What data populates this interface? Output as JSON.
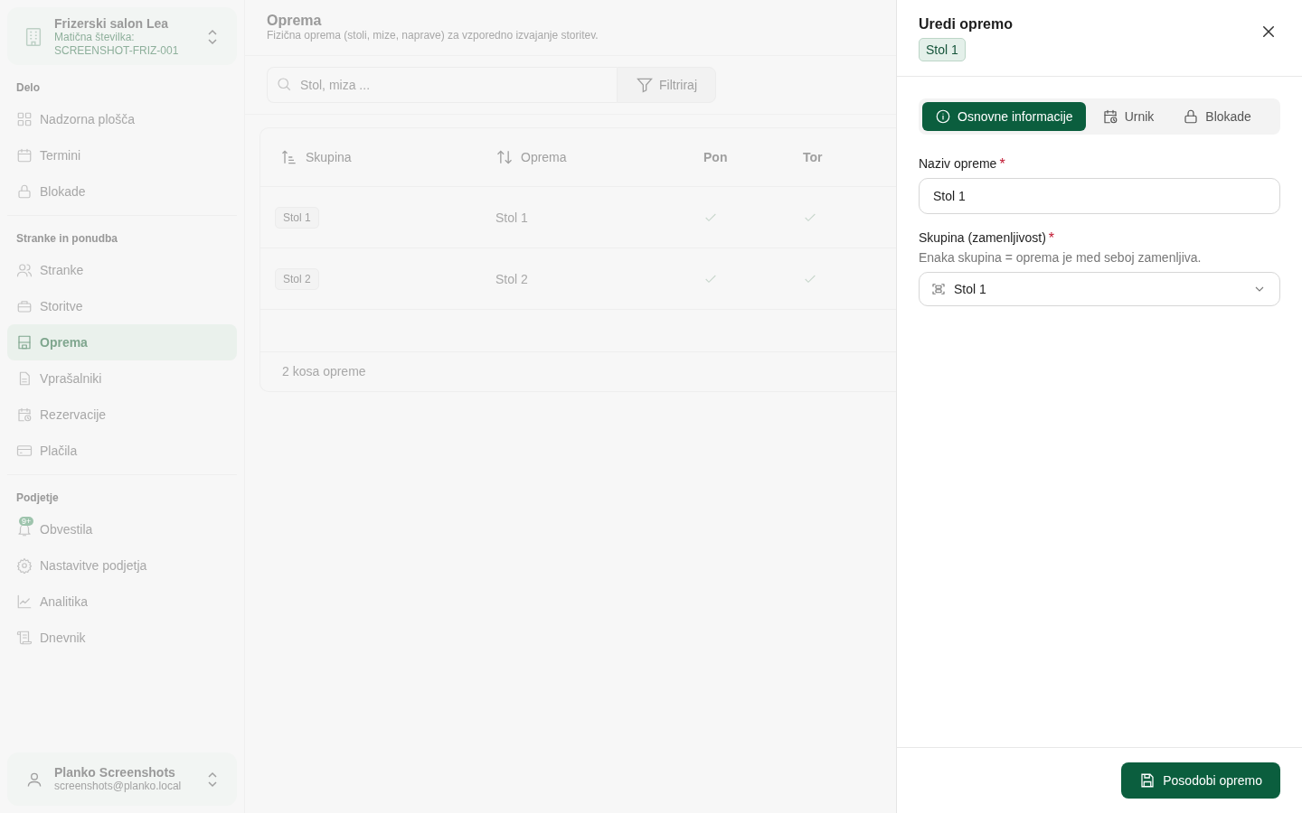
{
  "sidebar": {
    "org": {
      "name": "Frizerski salon Lea",
      "id_label": "Matična številka:",
      "id_value": "SCREENSHOT-FRIZ-001"
    },
    "sections": [
      {
        "title": "Delo",
        "items": [
          {
            "label": "Nadzorna plošča",
            "kind": "dashboard",
            "selected": false
          },
          {
            "label": "Termini",
            "kind": "calendar",
            "selected": false
          },
          {
            "label": "Blokade",
            "kind": "lock",
            "selected": false
          }
        ]
      },
      {
        "title": "Stranke in ponudba",
        "items": [
          {
            "label": "Stranke",
            "kind": "users",
            "selected": false
          },
          {
            "label": "Storitve",
            "kind": "briefcase",
            "selected": false
          },
          {
            "label": "Oprema",
            "kind": "equipment",
            "selected": true
          },
          {
            "label": "Vprašalniki",
            "kind": "document",
            "selected": false
          },
          {
            "label": "Rezervacije",
            "kind": "calendarclock",
            "selected": false
          },
          {
            "label": "Plačila",
            "kind": "card",
            "selected": false
          }
        ]
      },
      {
        "title": "Podjetje",
        "items": [
          {
            "label": "Obvestila",
            "kind": "bell",
            "selected": false,
            "badge": "9+"
          },
          {
            "label": "Nastavitve podjetja",
            "kind": "gear",
            "selected": false
          },
          {
            "label": "Analitika",
            "kind": "chart",
            "selected": false
          },
          {
            "label": "Dnevnik",
            "kind": "scroll",
            "selected": false
          }
        ]
      }
    ],
    "user": {
      "name": "Planko Screenshots",
      "email": "screenshots@planko.local"
    }
  },
  "main": {
    "title": "Oprema",
    "subtitle": "Fizična oprema (stoli, mize, naprave) za vzporedno izvajanje storitev.",
    "search": {
      "placeholder": "Stol, miza ..."
    },
    "filter_button": "Filtriraj",
    "table": {
      "columns": [
        {
          "label": "Skupina",
          "kind": "ascending"
        },
        {
          "label": "Oprema",
          "kind": "sortable"
        },
        {
          "label": "Pon",
          "kind": "plain"
        },
        {
          "label": "Tor",
          "kind": "plain"
        }
      ],
      "rows": [
        {
          "group": "Stol 1",
          "name": "Stol 1",
          "days": [
            true,
            true
          ]
        },
        {
          "group": "Stol 2",
          "name": "Stol 2",
          "days": [
            true,
            true
          ]
        }
      ],
      "footer": "2 kosa opreme"
    }
  },
  "drawer": {
    "title": "Uredi opremo",
    "badge": "Stol 1",
    "tabs": [
      {
        "label": "Osnovne informacije",
        "kind": "info",
        "selected": true
      },
      {
        "label": "Urnik",
        "kind": "calendarclock",
        "selected": false
      },
      {
        "label": "Blokade",
        "kind": "lock",
        "selected": false
      }
    ],
    "fields": [
      {
        "kind": "text",
        "label": "Naziv opreme",
        "required_mark": "*",
        "value": "Stol 1"
      },
      {
        "kind": "select",
        "label": "Skupina (zamenljivost)",
        "required_mark": "*",
        "hint": "Enaka skupina = oprema je med seboj zamenljiva.",
        "value": "Stol 1"
      }
    ],
    "submit_button": "Posodobi opremo"
  }
}
